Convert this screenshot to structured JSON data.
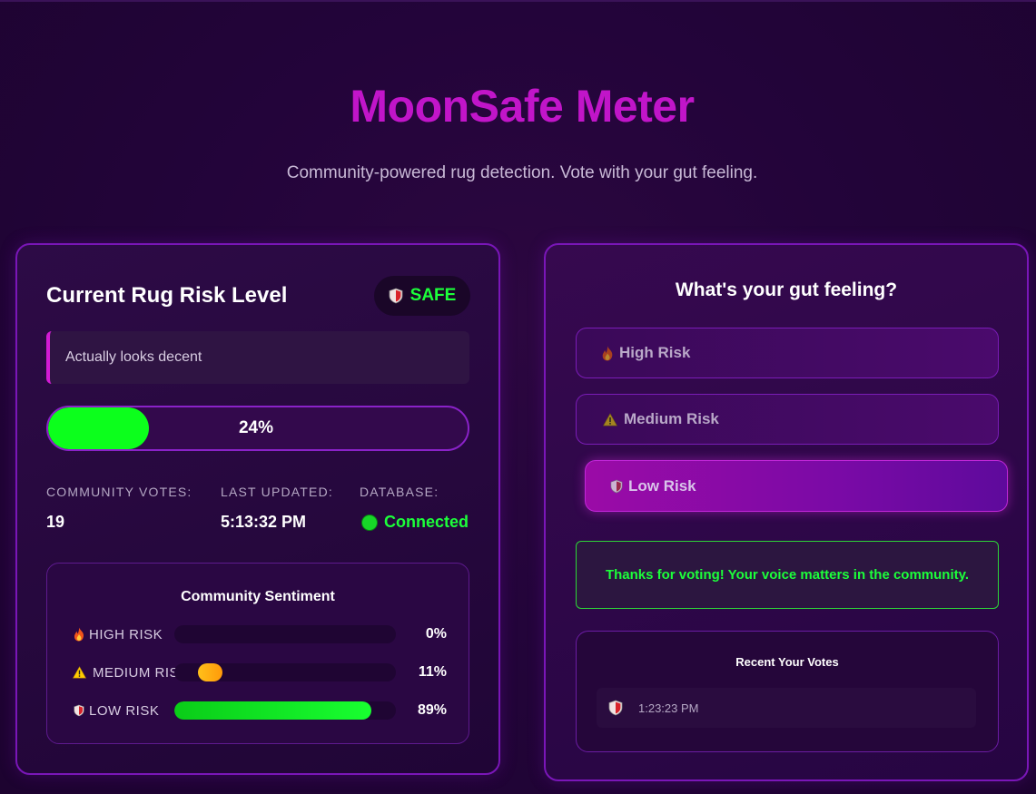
{
  "header": {
    "title": "MoonSafe Meter",
    "subtitle": "Community-powered rug detection. Vote with your gut feeling."
  },
  "risk_panel": {
    "title": "Current Rug Risk Level",
    "badge_icon": "shield-icon",
    "badge_label": "SAFE",
    "message": "Actually looks decent",
    "meter_percent": 24,
    "meter_label": "24%",
    "stats": {
      "votes_label": "COMMUNITY VOTES:",
      "votes_value": "19",
      "updated_label": "LAST UPDATED:",
      "updated_value": "5:13:32 PM",
      "database_label": "DATABASE:",
      "database_value": "Connected"
    }
  },
  "sentiment": {
    "title": "Community Sentiment",
    "rows": [
      {
        "icon": "fire-icon",
        "label": "HIGH RISK",
        "percent": 0,
        "percent_label": "0%",
        "color": "#ff3b3b"
      },
      {
        "icon": "warning-icon",
        "label": "MEDIUM RISK",
        "percent": 11,
        "percent_label": "11%",
        "color": "#ffb000"
      },
      {
        "icon": "shield-icon",
        "label": "LOW RISK",
        "percent": 89,
        "percent_label": "89%",
        "color": "#0cff1c"
      }
    ]
  },
  "vote_panel": {
    "title": "What's your gut feeling?",
    "options": [
      {
        "icon": "fire-icon",
        "label": "High Risk",
        "selected": false
      },
      {
        "icon": "warning-icon",
        "label": "Medium Risk",
        "selected": false
      },
      {
        "icon": "shield-icon",
        "label": "Low Risk",
        "selected": true
      }
    ],
    "thanks_message": "Thanks for voting! Your voice matters in the community.",
    "recent_title": "Recent Your Votes",
    "recent_votes": [
      {
        "icon": "shield-icon",
        "time": "1:23:23 PM"
      }
    ]
  },
  "colors": {
    "accent": "#c115c9",
    "safe_green": "#1cff3a",
    "border_purple": "#7a16b8"
  }
}
